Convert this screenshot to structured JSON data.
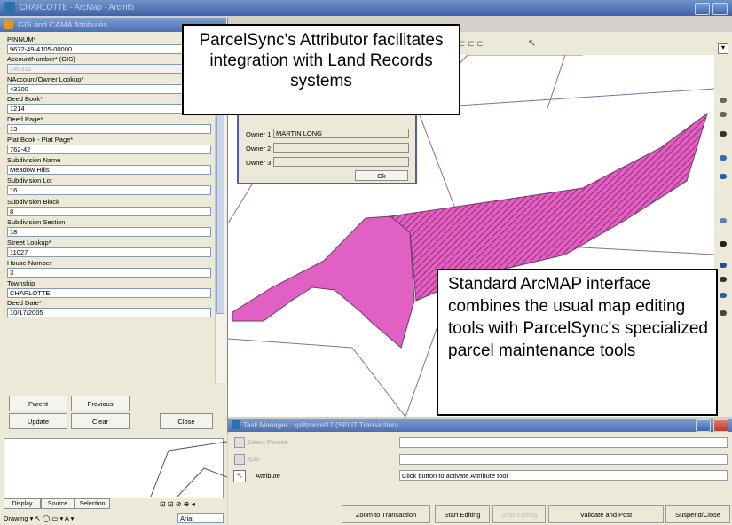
{
  "app": {
    "title": "CHARLOTTE - ArcMap - ArcInfo"
  },
  "attributes_panel": {
    "title": "GIS and CAMA Attributes",
    "fields": [
      {
        "label": "PINNUM*",
        "value": "9672-49-4105-00000"
      },
      {
        "label": "AccountNumber* (GIS)",
        "value": "140311"
      },
      {
        "label": "NAccount/Owner Lookup*",
        "value": "43300"
      },
      {
        "label": "Deed Book*",
        "value": "1214"
      },
      {
        "label": "Deed Page*",
        "value": "13"
      },
      {
        "label": "Plat Book - Plat Page*",
        "value": "762-42"
      },
      {
        "label": "Subdivision Name",
        "value": "Meadow Hills"
      },
      {
        "label": "Subdivision Lot",
        "value": "16"
      },
      {
        "label": "Subdivision Block",
        "value": "8"
      },
      {
        "label": "Subdivision Section",
        "value": "18"
      },
      {
        "label": "Street Lookup*",
        "value": "11027"
      },
      {
        "label": "House Number",
        "value": "3"
      },
      {
        "label": "Township",
        "value": "CHARLOTTE"
      },
      {
        "label": "Deed Date*",
        "value": "10/17/2005"
      }
    ],
    "buttons": {
      "parent": "Parent",
      "previous": "Previous",
      "update": "Update",
      "clear": "Clear",
      "close": "Close"
    }
  },
  "owner_dialog": {
    "owner1_label": "Owner 1",
    "owner1_value": "MARTIN LONG",
    "owner2_label": "Owner 2",
    "owner3_label": "Owner 3",
    "ok": "Ok"
  },
  "callouts": {
    "attributor": "ParcelSync's Attributor facilitates integration with Land Records systems",
    "arcmap": "Standard ArcMAP interface combines the usual map editing tools with ParcelSync's specialized parcel maintenance tools"
  },
  "task_manager": {
    "title": "Task Manager : splitparcel17 (SPLIT Transaction)",
    "rows": [
      {
        "label": "Select Parcels",
        "value": ""
      },
      {
        "label": "Split",
        "value": ""
      },
      {
        "label": "Attribute",
        "value": "Click button to activate Attribute tool"
      }
    ],
    "buttons": [
      "Zoom to Transaction",
      "Start Editing",
      "Stop Editing",
      "Validate and Post",
      "Suspend/Close"
    ]
  },
  "toc": {
    "tabs": [
      "Display",
      "Source",
      "Selection"
    ],
    "drawing": "Drawing",
    "font": "Arial"
  },
  "colors": {
    "parcel_fill": "#e060c4",
    "parcel_hatch": "#b0306e",
    "title_bar": "#4b6fb1"
  }
}
